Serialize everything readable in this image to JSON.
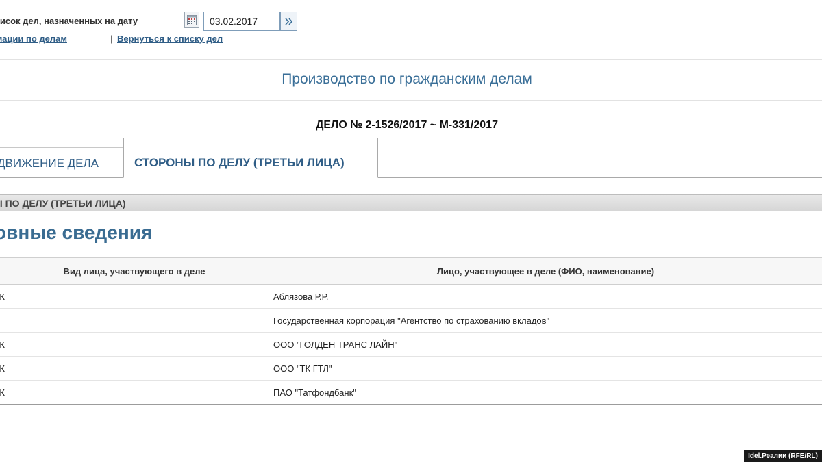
{
  "filter": {
    "date_label": "писок дел, назначенных на дату",
    "date_value": "03.02.2017"
  },
  "links": {
    "info": "ормации по делам",
    "separator": "|",
    "back": "Вернуться к списку дел"
  },
  "section_title": "Производство по гражданским делам",
  "case_number": "ДЕЛО № 2-1526/2017 ~ М-331/2017",
  "tabs": [
    {
      "label": "ДВИЖЕНИЕ ДЕЛА",
      "active": false
    },
    {
      "label": "СТОРОНЫ ПО ДЕЛУ (ТРЕТЬИ ЛИЦА)",
      "active": true
    }
  ],
  "panel_header": "Ы ПО ДЕЛУ (ТРЕТЬИ ЛИЦА)",
  "subsection_title": "овные сведения",
  "table": {
    "headers": [
      "Вид лица, участвующего в деле",
      "Лицо, участвующее в деле (ФИО, наименование)"
    ],
    "rows": [
      [
        "ИК",
        "Аблязова Р.Р."
      ],
      [
        "",
        "Государственная корпорация \"Агентство по страхованию вкладов\""
      ],
      [
        "ИК",
        "ООО \"ГОЛДЕН ТРАНС ЛАЙН\""
      ],
      [
        "ИК",
        "ООО \"ТК ГТЛ\""
      ],
      [
        "ИК",
        "ПАО \"Татфондбанк\""
      ]
    ]
  },
  "watermark": "Idel.Реалии (RFE/RL)",
  "colors": {
    "link": "#2f5d86",
    "title": "#3a6f98",
    "panel": "#dcdcdc"
  }
}
